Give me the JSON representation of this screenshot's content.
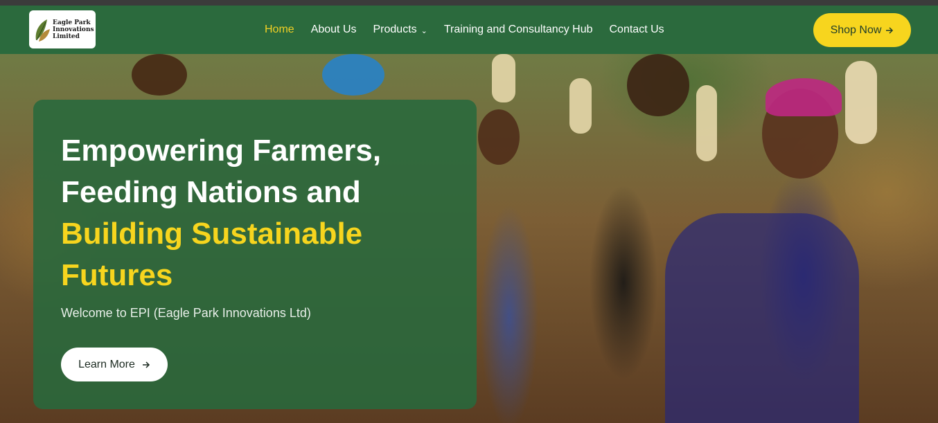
{
  "brand": {
    "logo_text": "Eagle Park Innovations Limited"
  },
  "nav": {
    "items": [
      {
        "label": "Home",
        "active": true
      },
      {
        "label": "About Us"
      },
      {
        "label": "Products",
        "has_dropdown": true
      },
      {
        "label": "Training and Consultancy Hub"
      },
      {
        "label": "Contact Us"
      }
    ],
    "shop_button": "Shop Now",
    "chevron_icon": "chevron-down-icon",
    "arrow_icon": "arrow-right-icon"
  },
  "hero": {
    "headline_white_1": "Empowering Farmers,",
    "headline_white_2": "Feeding Nations and",
    "headline_yellow_1": "Building Sustainable",
    "headline_yellow_2": "Futures",
    "subtitle": "Welcome to EPI (Eagle Park Innovations Ltd)",
    "cta": "Learn More"
  },
  "colors": {
    "nav_bg": "#2b6a3d",
    "accent_yellow": "#f7d51e",
    "active_link": "#f2d024",
    "card_bg": "rgba(40,105,60,0.88)"
  }
}
